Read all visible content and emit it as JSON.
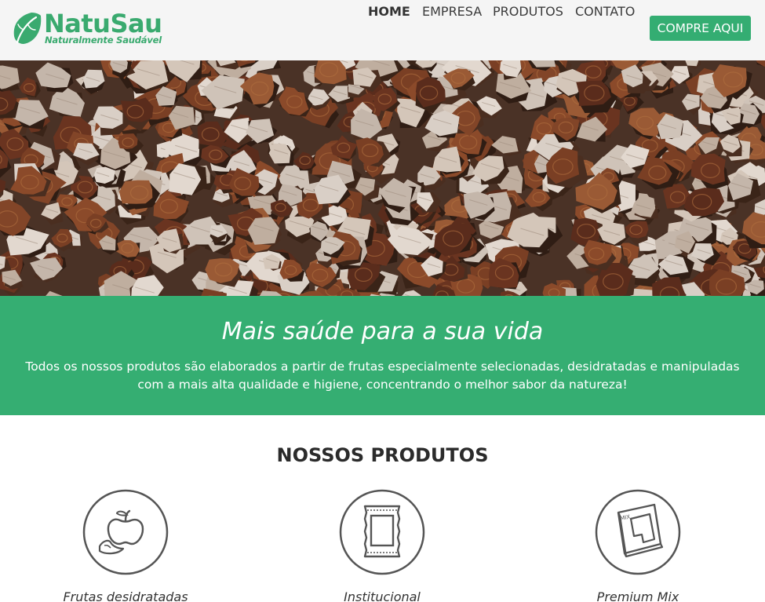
{
  "brand": {
    "name": "NatuSau",
    "tagline": "Naturalmente Saudável",
    "color": "#3aaa6f"
  },
  "nav": {
    "items": [
      {
        "label": "HOME",
        "active": true
      },
      {
        "label": "EMPRESA",
        "active": false
      },
      {
        "label": "PRODUTOS",
        "active": false
      },
      {
        "label": "CONTATO",
        "active": false
      }
    ],
    "cta_label": "COMPRE AQUI",
    "cta_color": "#34ad72"
  },
  "hero": {
    "image": "dried-banana-slices-photo"
  },
  "banner": {
    "title": "Mais saúde para a sua vida",
    "text": "Todos os nossos produtos são elaborados a partir de frutas especialmente selecionadas, desidratadas e manipuladas com a mais alta qualidade e higiene, concentrando o melhor sabor da natureza!",
    "color": "#35ae72"
  },
  "products": {
    "title": "NOSSOS PRODUTOS",
    "items": [
      {
        "label": "Frutas desidratadas",
        "icon": "apple-icon"
      },
      {
        "label": "Institucional",
        "icon": "package-icon"
      },
      {
        "label": "Premium Mix",
        "icon": "mix-box-icon"
      }
    ]
  }
}
